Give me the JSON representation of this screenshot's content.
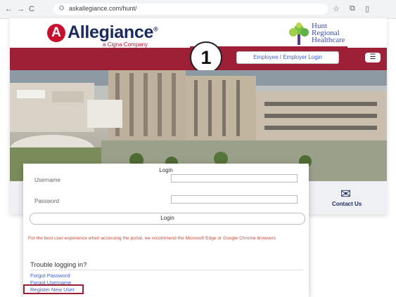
{
  "browser": {
    "back": "←",
    "forward": "→",
    "reload": "C",
    "site_settings": "⛭",
    "url": "askallegiance.com/hunt/",
    "star": "☆",
    "extensions": "⧉",
    "sidepanel": "▯"
  },
  "header": {
    "brand_name": "Allegiance",
    "brand_mark": "A",
    "brand_reg": "®",
    "brand_sub": "a Cigna Company",
    "partner_line1": "Hunt",
    "partner_line2": "Regional",
    "partner_line3": "Healthcare"
  },
  "nav": {
    "login_button": "Employee / Employer Login",
    "menu_glyph": "☰",
    "step_number": "1"
  },
  "tiles": {
    "contact_icon": "✉",
    "contact_label": "Contact Us"
  },
  "login": {
    "title": "Login",
    "username_label": "Username",
    "password_label": "Password",
    "submit_label": "Login",
    "recommendation": "For the best user experience when accessing the portal, we recommend the Microsoft Edge or Google Chrome browsers",
    "trouble_heading": "Trouble logging in?",
    "forgot_password": "Forgot Password",
    "forgot_username": "Forgot Username",
    "register": "Register New User"
  },
  "colors": {
    "brand_red": "#9e2036",
    "brand_navy": "#1a2a5e",
    "link_blue": "#3d5ed6"
  }
}
